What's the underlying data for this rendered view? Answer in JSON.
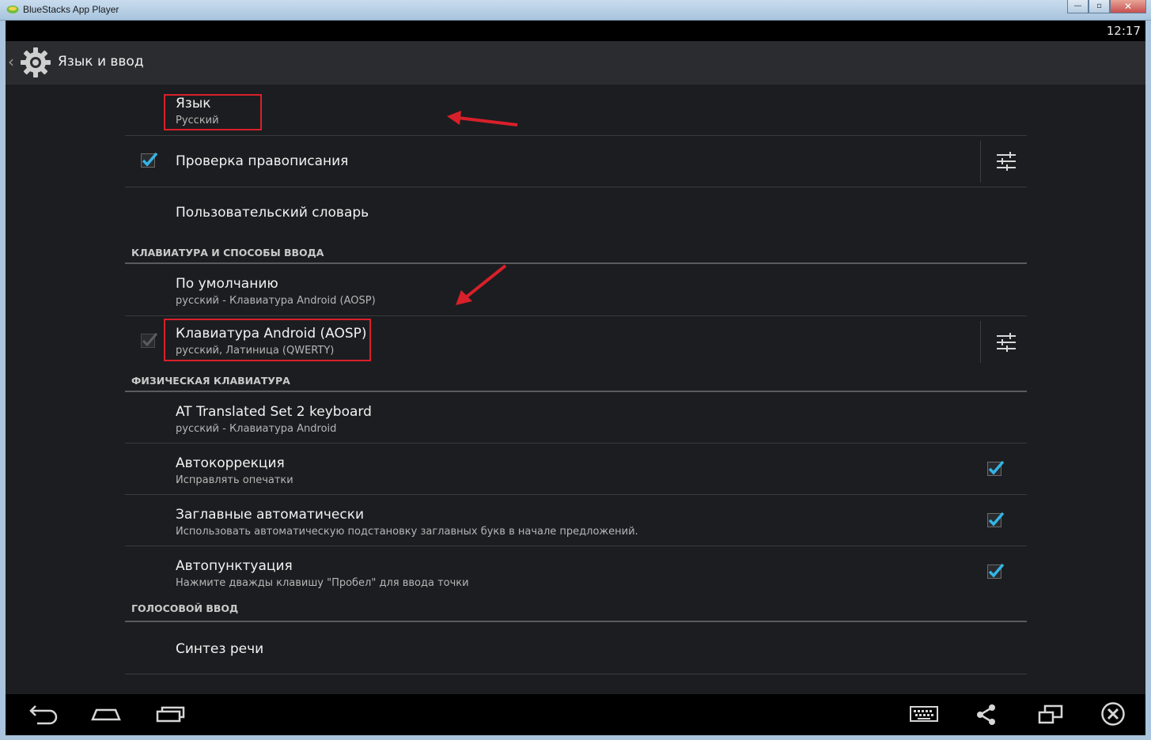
{
  "window": {
    "title": "BlueStacks App Player",
    "buttons": {
      "minimize": "—",
      "maximize": "▫",
      "close": "✕"
    }
  },
  "status_bar": {
    "time": "12:17"
  },
  "action_bar": {
    "title": "Язык и ввод",
    "icon": "gear-icon"
  },
  "items": {
    "language": {
      "title": "Язык",
      "summary": "Русский"
    },
    "spellcheck": {
      "title": "Проверка правописания",
      "checked": true
    },
    "user_dictionary": {
      "title": "Пользовательский словарь"
    },
    "default_keyboard": {
      "title": "По умолчанию",
      "summary": "русский - Клавиатура Android (AOSP)"
    },
    "aosp_keyboard": {
      "title": "Клавиатура Android (AOSP)",
      "summary": "русский, Латиница (QWERTY)",
      "checked": true
    },
    "at_keyboard": {
      "title": "AT Translated Set 2 keyboard",
      "summary": "русский - Клавиатура Android"
    },
    "autocorrect": {
      "title": "Автокоррекция",
      "summary": "Исправлять опечатки",
      "checked": true
    },
    "autocaps": {
      "title": "Заглавные автоматически",
      "summary": "Использовать автоматическую подстановку заглавных букв в начале предложений.",
      "checked": true
    },
    "autopunct": {
      "title": "Автопунктуация",
      "summary": "Нажмите дважды клавишу \"Пробел\" для ввода точки",
      "checked": true
    },
    "tts": {
      "title": "Синтез речи"
    }
  },
  "categories": {
    "keyboard": "КЛАВИАТУРА И СПОСОБЫ ВВОДА",
    "physical": "ФИЗИЧЕСКАЯ КЛАВИАТУРА",
    "voice": "ГОЛОСОВОЙ ВВОД"
  },
  "nav_bar": {
    "left": [
      "back-icon",
      "home-icon",
      "recent-apps-icon"
    ],
    "right": [
      "keyboard-icon",
      "share-icon",
      "rotate-screen-icon",
      "close-app-icon"
    ]
  },
  "colors": {
    "accent_check": "#33b5e5",
    "annotation_red": "#d8202a"
  }
}
